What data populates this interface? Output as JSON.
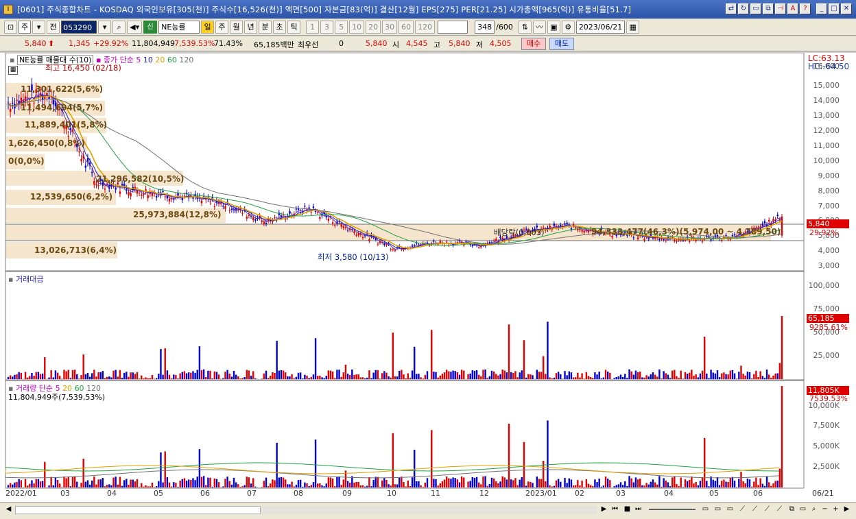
{
  "window": {
    "title": "[0601] 주식종합차트 - KOSDAQ 외국인보유[305(천)] 주식수[16,526(천)] 액면[500] 자본금[83(억)] 결산[12월] EPS[275] PER[21.25] 시가총액[965(억)] 유통비율[51.7]",
    "app_icon": "I"
  },
  "toolbar": {
    "market": "주",
    "prev_label": "전",
    "code": "053290",
    "name": "NE능률",
    "cat_tag": "신",
    "periods": [
      "일",
      "주",
      "월",
      "년",
      "분",
      "초",
      "틱"
    ],
    "selected_period": "일",
    "minutes": [
      "1",
      "3",
      "5",
      "10",
      "20",
      "30",
      "60",
      "120"
    ],
    "count": "348",
    "count_total": "/600",
    "date": "2023/06/21"
  },
  "quote": {
    "price": "5,840",
    "change": "1,345",
    "change_pct": "+29.92%",
    "volume": "11,804,949",
    "vol_ratio": "7,539.53%",
    "turnover": "71.43%",
    "amount": "65,185백만",
    "priority_label": "최우선",
    "priority_val": "0",
    "price2": "5,840",
    "open_label": "시",
    "open": "4,545",
    "high_label": "고",
    "high": "5,840",
    "low_label": "저",
    "low": "4,505",
    "buy": "매수",
    "sell": "매도"
  },
  "price_pane": {
    "name_label": "NE능률 매물대 수(10)",
    "ma_label": "종가 단순",
    "ma_periods": [
      "5",
      "10",
      "20",
      "60",
      "120"
    ],
    "ma_colors": [
      "#7030a0",
      "#2020c0",
      "#e0a000",
      "#20a040",
      "#707070"
    ],
    "high_marker": "최고 16,450 (02/18)",
    "low_marker": "최저 3,580 (10/13)",
    "dividend": "배당락(0.003)",
    "lc": "LC:63.13",
    "hc": "HC:-64.50",
    "current_price_tag": "5,840",
    "current_pct_tag": "29.92%",
    "y_ticks": [
      "16,000",
      "15,000",
      "14,000",
      "13,000",
      "12,000",
      "11,000",
      "10,000",
      "9,000",
      "8,000",
      "7,000",
      "6,000",
      "5,000",
      "4,000",
      "3,000"
    ],
    "volume_profile": [
      "11,301,622(5,6%)",
      "11,494,694(5,7%)",
      "11,889,401(5,8%)",
      "1,626,450(0,8%)",
      "0(0,0%)",
      "21,296,582(10,5%)",
      "12,539,650(6,2%)",
      "25,973,884(12,8%)",
      "94,333,477(46,3%)(5,974,00 ~ 4,789,50)",
      "13,026,713(6,4%)"
    ]
  },
  "amount_pane": {
    "label": "거래대금",
    "y_ticks": [
      "100,000",
      "75,000",
      "50,000",
      "25,000"
    ],
    "tag1": "65,185",
    "tag2": "9285.61%"
  },
  "volume_pane": {
    "label": "거래량 단순",
    "ma_periods": [
      "5",
      "20",
      "60",
      "120"
    ],
    "current": "11,804,949주(7,539,53%)",
    "y_ticks": [
      "10,000K",
      "7,500K",
      "5,000K",
      "2,500K"
    ],
    "tag1": "11,805K",
    "tag2": "7539.53%"
  },
  "x_axis": [
    "2022/01",
    "03",
    "04",
    "05",
    "06",
    "07",
    "08",
    "09",
    "10",
    "11",
    "12",
    "2023/01",
    "02",
    "03",
    "04",
    "05",
    "06",
    "06/21"
  ],
  "colors": {
    "up": "#e00000",
    "down": "#0000d0",
    "title_bg": "#2b54a8",
    "tag": "#e00000"
  },
  "chart_data": {
    "type": "candlestick+volume",
    "close_series_approx": [
      {
        "x": "2022/01",
        "y": 13500
      },
      {
        "x": "2022/02",
        "y": 14200
      },
      {
        "x": "2022/03",
        "y": 8200
      },
      {
        "x": "2022/04",
        "y": 7600
      },
      {
        "x": "2022/05",
        "y": 7200
      },
      {
        "x": "2022/06",
        "y": 6700
      },
      {
        "x": "2022/07",
        "y": 5500
      },
      {
        "x": "2022/08",
        "y": 6400
      },
      {
        "x": "2022/09",
        "y": 4900
      },
      {
        "x": "2022/10",
        "y": 3700
      },
      {
        "x": "2022/11",
        "y": 4100
      },
      {
        "x": "2022/12",
        "y": 3900
      },
      {
        "x": "2023/01",
        "y": 4800
      },
      {
        "x": "2023/02",
        "y": 5200
      },
      {
        "x": "2023/03",
        "y": 4700
      },
      {
        "x": "2023/04",
        "y": 4400
      },
      {
        "x": "2023/05",
        "y": 4300
      },
      {
        "x": "2023/06/20",
        "y": 4495
      },
      {
        "x": "2023/06/21",
        "y": 5840
      }
    ],
    "ylim": [
      3000,
      16450
    ],
    "volume_ylim_k": [
      0,
      12000
    ]
  }
}
